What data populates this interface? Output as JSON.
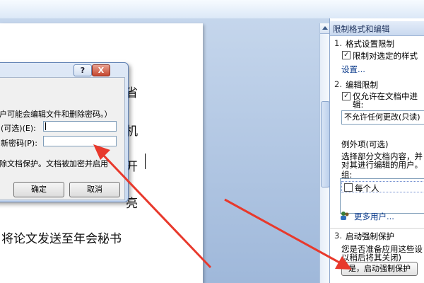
{
  "document": {
    "fragment_1": "省",
    "fragment_2": "机",
    "fragment_3": "开",
    "fragment_4": "亮",
    "line_main": "将论文发送至年会秘书"
  },
  "dialog": {
    "help_label": "?",
    "close_label": "X",
    "warning_text": "户可能会编辑文件和删除密码。）",
    "password_label": "(可选)(E):",
    "confirm_label": "新密码(P):",
    "info_text": "除文档保护。文档被加密并启用",
    "ok_label": "确定",
    "cancel_label": "取消"
  },
  "pane": {
    "title": "限制格式和编辑",
    "section1_num": "1.",
    "section1_title": "格式设置限制",
    "section1_checkbox_label": "限制对选定的样式",
    "section1_settings_link": "设置...",
    "section2_num": "2.",
    "section2_title": "编辑限制",
    "section2_checkbox_label_line1": "仅允许在文档中进",
    "section2_checkbox_label_line2": "辑:",
    "section2_select_value": "不允许任何更改(只读)",
    "exceptions_title": "例外项(可选)",
    "exceptions_desc_line1": "选择部分文档内容，并",
    "exceptions_desc_line2": "对其进行编辑的用户。",
    "groups_label": "组:",
    "group_everyone": "每个人",
    "more_users_link": "更多用户...",
    "section3_num": "3.",
    "section3_title": "启动强制保护",
    "section3_desc_line1": "您是否准备应用这些设",
    "section3_desc_line2": "以稍后将其关闭)",
    "start_button_label": "是，启动强制保护"
  },
  "colors": {
    "arrow": "#e8392c",
    "accent_blue": "#1f4e9b"
  }
}
